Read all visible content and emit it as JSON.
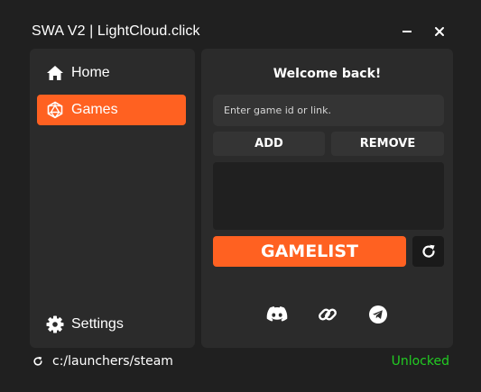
{
  "window": {
    "title": "SWA V2 | LightCloud.click"
  },
  "sidebar": {
    "items": [
      {
        "label": "Home",
        "icon": "home-icon",
        "active": false
      },
      {
        "label": "Games",
        "icon": "dice-icon",
        "active": true
      },
      {
        "label": "Settings",
        "icon": "gear-icon",
        "active": false
      }
    ]
  },
  "main": {
    "welcome": "Welcome back!",
    "input_placeholder": "Enter game id or link.",
    "input_value": "",
    "add_label": "ADD",
    "remove_label": "REMOVE",
    "gamelist_label": "GAMELIST",
    "social": [
      "discord-icon",
      "link-icon",
      "telegram-icon"
    ]
  },
  "status": {
    "path": "c:/launchers/steam",
    "state": "Unlocked",
    "state_color": "#22cc22"
  },
  "colors": {
    "accent": "#ff6121",
    "background": "#202020",
    "panel": "#2b2b2b"
  }
}
